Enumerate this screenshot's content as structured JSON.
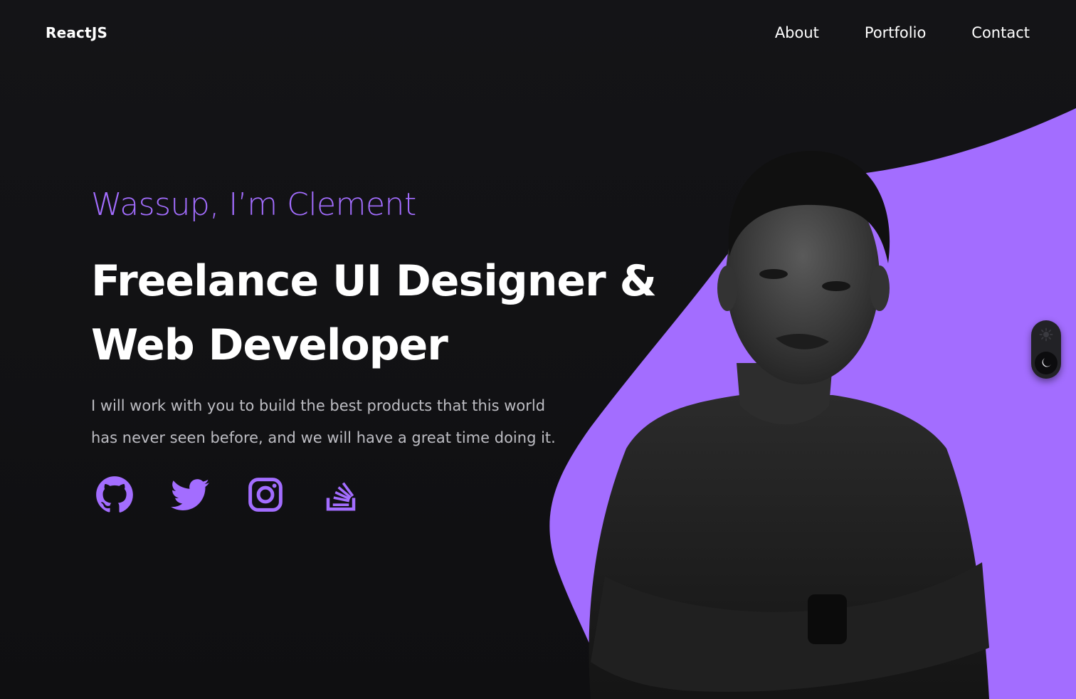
{
  "header": {
    "brand": "ReactJS",
    "nav": [
      "About",
      "Portfolio",
      "Contact"
    ]
  },
  "hero": {
    "greeting": "Wassup, I’m Clement",
    "headline_line1": "Freelance UI Designer &",
    "headline_line2": "Web Developer",
    "description": "I will work with you to build the best products that this world has never seen before, and we will have a great time doing it."
  },
  "socials": [
    "github-icon",
    "twitter-icon",
    "instagram-icon",
    "stackoverflow-icon"
  ],
  "theme_toggle": {
    "options": [
      "sun-icon",
      "moon-icon"
    ],
    "selected": "moon-icon"
  },
  "colors": {
    "background": "#131316",
    "accent": "#a36dff",
    "text": "#ffffff",
    "muted_text": "#bdbdc3"
  }
}
